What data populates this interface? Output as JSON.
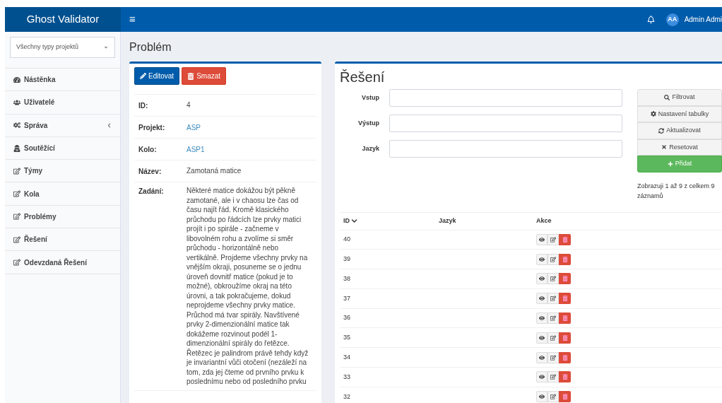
{
  "header": {
    "brand": "Ghost Validator",
    "menu_toggle": "≡",
    "user": {
      "initials": "AA",
      "name": "Admin Admi"
    }
  },
  "sidebar": {
    "project_select": {
      "value": "Všechny typy projektů"
    },
    "items": [
      {
        "label": "Nástěnka",
        "kind": "dashboard",
        "expandable": false
      },
      {
        "label": "Uživatelé",
        "kind": "users",
        "expandable": false
      },
      {
        "label": "Správa",
        "kind": "cogs",
        "expandable": true
      },
      {
        "label": "Soutěžící",
        "kind": "user",
        "expandable": false
      },
      {
        "label": "Týmy",
        "kind": "edit",
        "expandable": false
      },
      {
        "label": "Kola",
        "kind": "edit",
        "expandable": false
      },
      {
        "label": "Problémy",
        "kind": "edit",
        "expandable": false
      },
      {
        "label": "Řešení",
        "kind": "edit",
        "expandable": false
      },
      {
        "label": "Odevzdaná Řešení",
        "kind": "edit",
        "expandable": false
      }
    ]
  },
  "page_title": "Problém",
  "problem": {
    "buttons": [
      {
        "label": "Editovat",
        "kind": "edit"
      },
      {
        "label": "Smazat",
        "kind": "delete"
      }
    ],
    "fields": [
      {
        "label": "ID:",
        "value": "4",
        "kind": "text"
      },
      {
        "label": "Projekt:",
        "value": "ASP",
        "kind": "link"
      },
      {
        "label": "Kolo:",
        "value": "ASP1",
        "kind": "link"
      },
      {
        "label": "Název:",
        "value": "Zamotaná matice",
        "kind": "text"
      },
      {
        "label": "Zadání:",
        "value": "Některé matice dokážou být pěkně zamotané, ale i v chaosu lze čas od času najít řád. Kromě klasického průchodu po řádcích lze prvky matici projít i po spirále - začneme v libovolném rohu a zvolíme si směr průchodu - horizontálně nebo vertikálně. Projdeme všechny prvky na vnějším okraji, posuneme se o jednu úroveň dovnitř matice (pokud je to možné), obkroužíme okraj na této úrovni, a tak pokračujeme, dokud neprojdeme všechny prvky matice. Průchod má tvar spirály. Navštívené prvky 2-dimenzionální matice tak dokážeme rozvinout podél 1-dimenzionální spirály do řetězce. Řetězec je palindrom právě tehdy když je invariantní vůči otočení (nezáleží na tom, zda jej čteme od prvního prvku k poslednímu nebo od posledního prvku",
        "kind": "text"
      }
    ]
  },
  "solutions": {
    "title": "Řešení",
    "filters": [
      {
        "label": "Vstup"
      },
      {
        "label": "Výstup"
      },
      {
        "label": "Jazyk"
      }
    ],
    "actions": [
      {
        "label": "Filtrovat",
        "kind": "search"
      },
      {
        "label": "Nastavení tabulky",
        "kind": "settings"
      },
      {
        "label": "Aktualizovat",
        "kind": "refresh"
      },
      {
        "label": "Resetovat",
        "kind": "reset"
      },
      {
        "label": "Přidat",
        "kind": "add"
      }
    ],
    "summary": "Zobrazuji 1 až 9 z celkem 9 záznamů",
    "table": {
      "columns": [
        {
          "label": "ID",
          "sorted": true
        },
        {
          "label": "Jazyk",
          "sorted": false
        },
        {
          "label": "Akce",
          "sorted": false
        }
      ],
      "rows": [
        {
          "id": "40"
        },
        {
          "id": "39"
        },
        {
          "id": "38"
        },
        {
          "id": "37"
        },
        {
          "id": "36"
        },
        {
          "id": "35"
        },
        {
          "id": "34"
        },
        {
          "id": "33"
        },
        {
          "id": "32"
        }
      ]
    }
  }
}
